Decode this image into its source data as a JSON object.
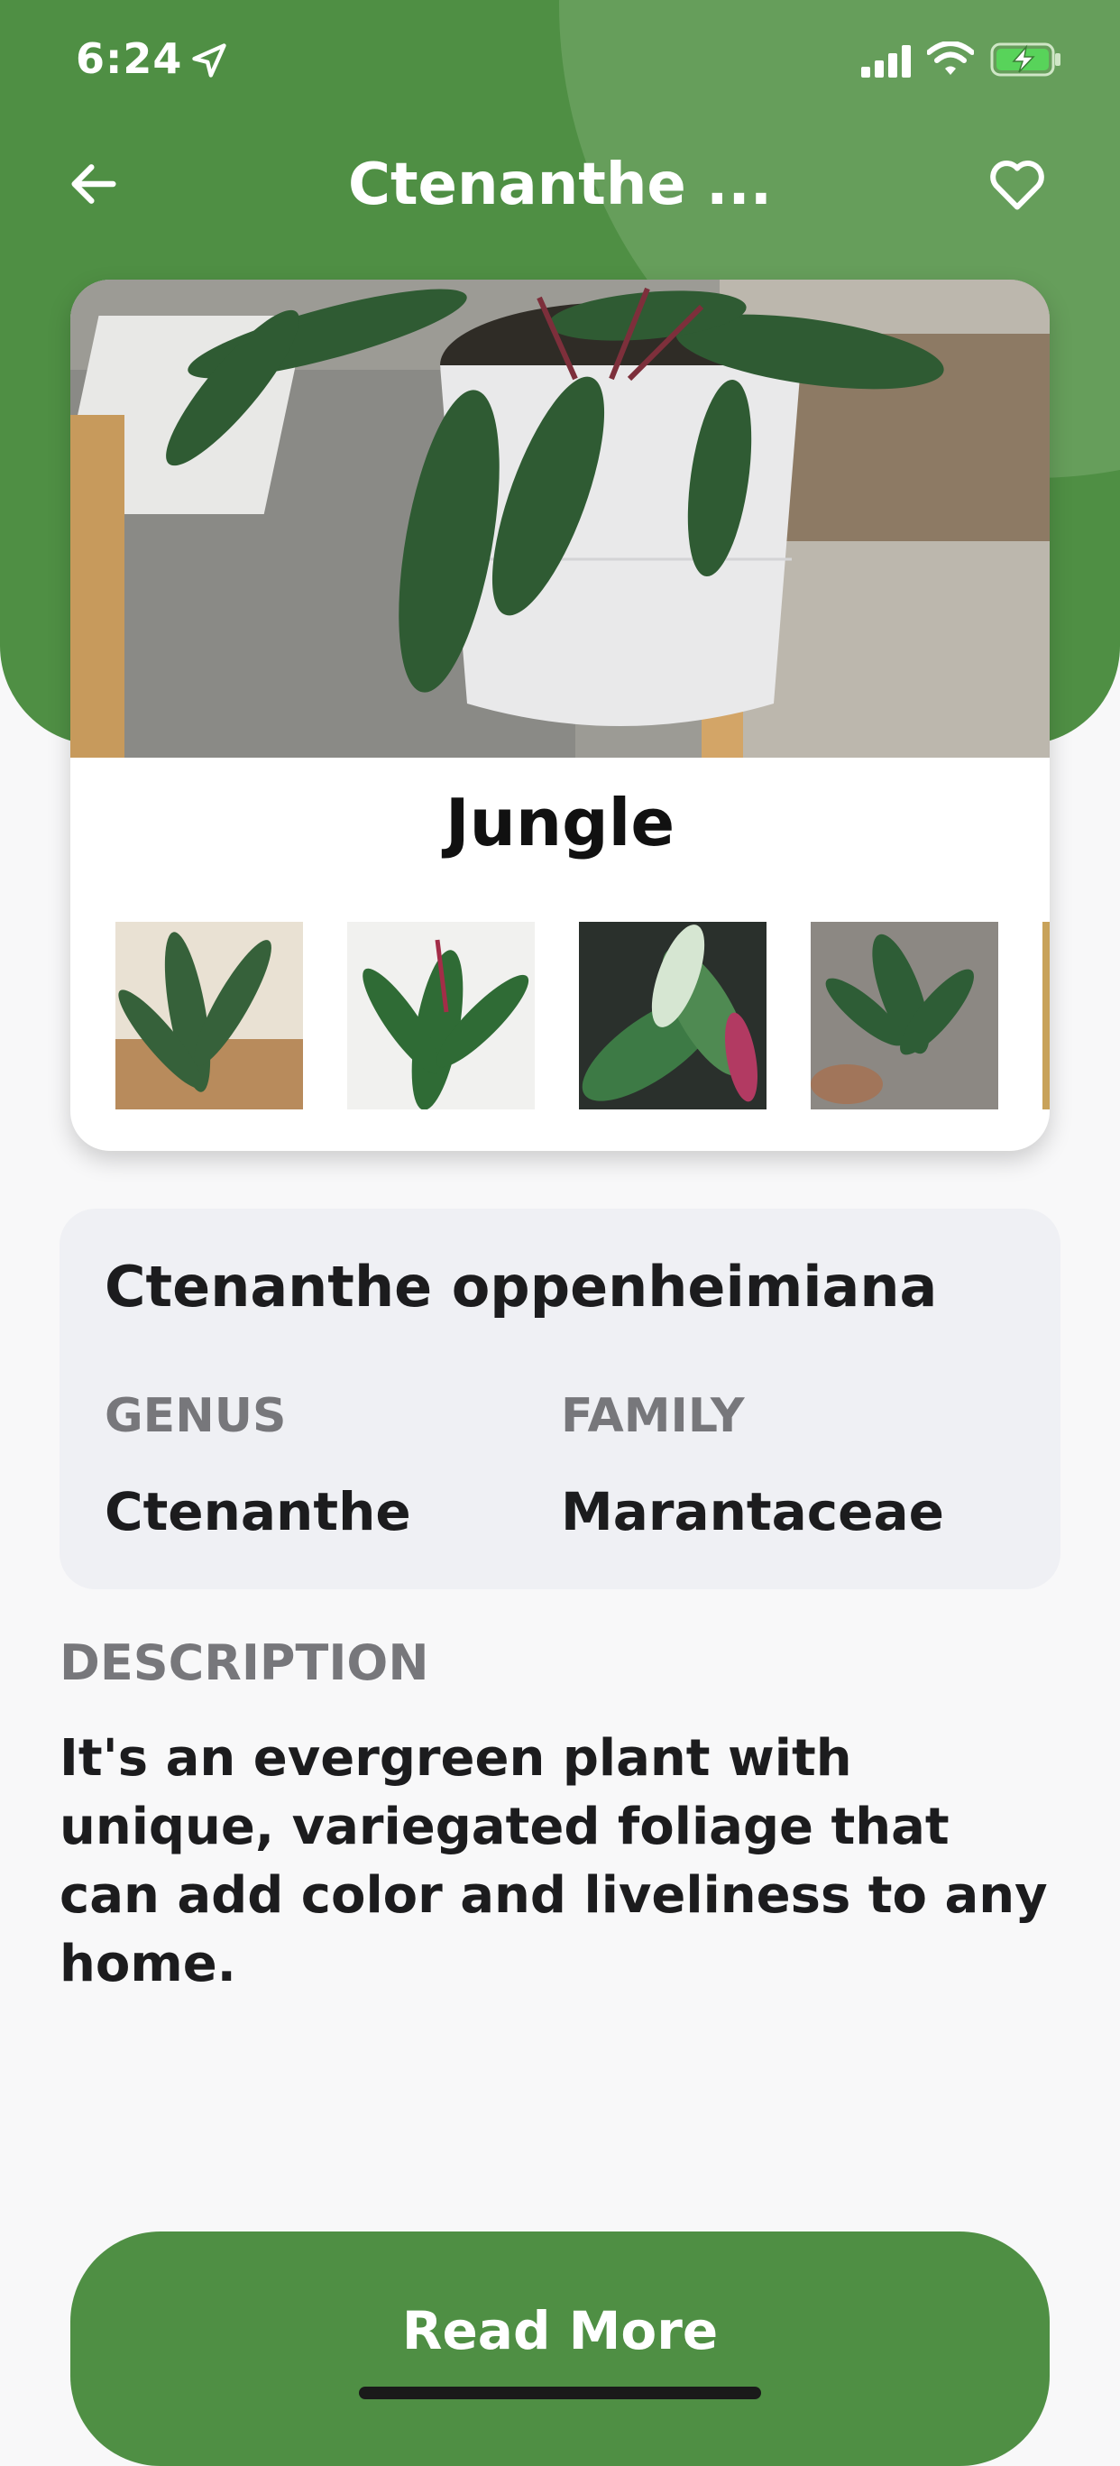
{
  "status_bar": {
    "time": "6:24",
    "icons": [
      "location-arrow-icon",
      "cellular-signal-icon",
      "wifi-icon",
      "battery-charging-icon"
    ]
  },
  "nav": {
    "title": "Ctenanthe ...",
    "back_icon": "arrow-left-icon",
    "favorite_icon": "heart-outline-icon"
  },
  "gallery": {
    "caption": "Jungle",
    "thumbnails": [
      "plant-photo-1",
      "plant-photo-2",
      "plant-photo-3",
      "plant-photo-4"
    ]
  },
  "plant": {
    "scientific_name": "Ctenanthe oppenheimiana",
    "genus_label": "GENUS",
    "genus": "Ctenanthe",
    "family_label": "FAMILY",
    "family": "Marantaceae"
  },
  "description": {
    "label": "DESCRIPTION",
    "text": "It's an evergreen plant with unique, variegated foliage that can add color and liveliness to any home."
  },
  "actions": {
    "read_more": "Read More"
  },
  "colors": {
    "brand_green": "#4f8f44",
    "header_highlight": "#6aa15f",
    "muted_label": "#77777b",
    "card_bg": "#eff0f4"
  }
}
